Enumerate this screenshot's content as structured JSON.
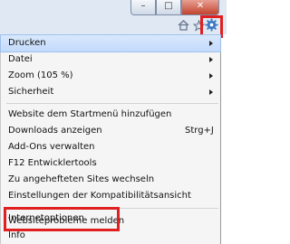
{
  "window": {
    "minimize_glyph": "–",
    "maximize_glyph": "□",
    "close_glyph": "✕"
  },
  "toolbar": {
    "icons": [
      "home-icon",
      "favorites-star-icon",
      "tools-gear-icon"
    ]
  },
  "menu": {
    "items": [
      {
        "label": "Drucken",
        "submenu": true,
        "highlighted": true
      },
      {
        "label": "Datei",
        "submenu": true
      },
      {
        "label": "Zoom (105 %)",
        "submenu": true
      },
      {
        "label": "Sicherheit",
        "submenu": true
      },
      {
        "label": "Website dem Startmenü hinzufügen"
      },
      {
        "label": "Downloads anzeigen",
        "shortcut": "Strg+J"
      },
      {
        "label": "Add-Ons verwalten"
      },
      {
        "label": "F12 Entwicklertools"
      },
      {
        "label": "Zu angehefteten Sites wechseln"
      },
      {
        "label": "Einstellungen der Kompatibilitätsansicht"
      },
      {
        "label": "Websiteprobleme melden"
      },
      {
        "label": "Internetoptionen"
      },
      {
        "label": "Info"
      }
    ]
  },
  "colors": {
    "highlight_frame": "#e02020",
    "menu_background": "#f5f5f5"
  }
}
